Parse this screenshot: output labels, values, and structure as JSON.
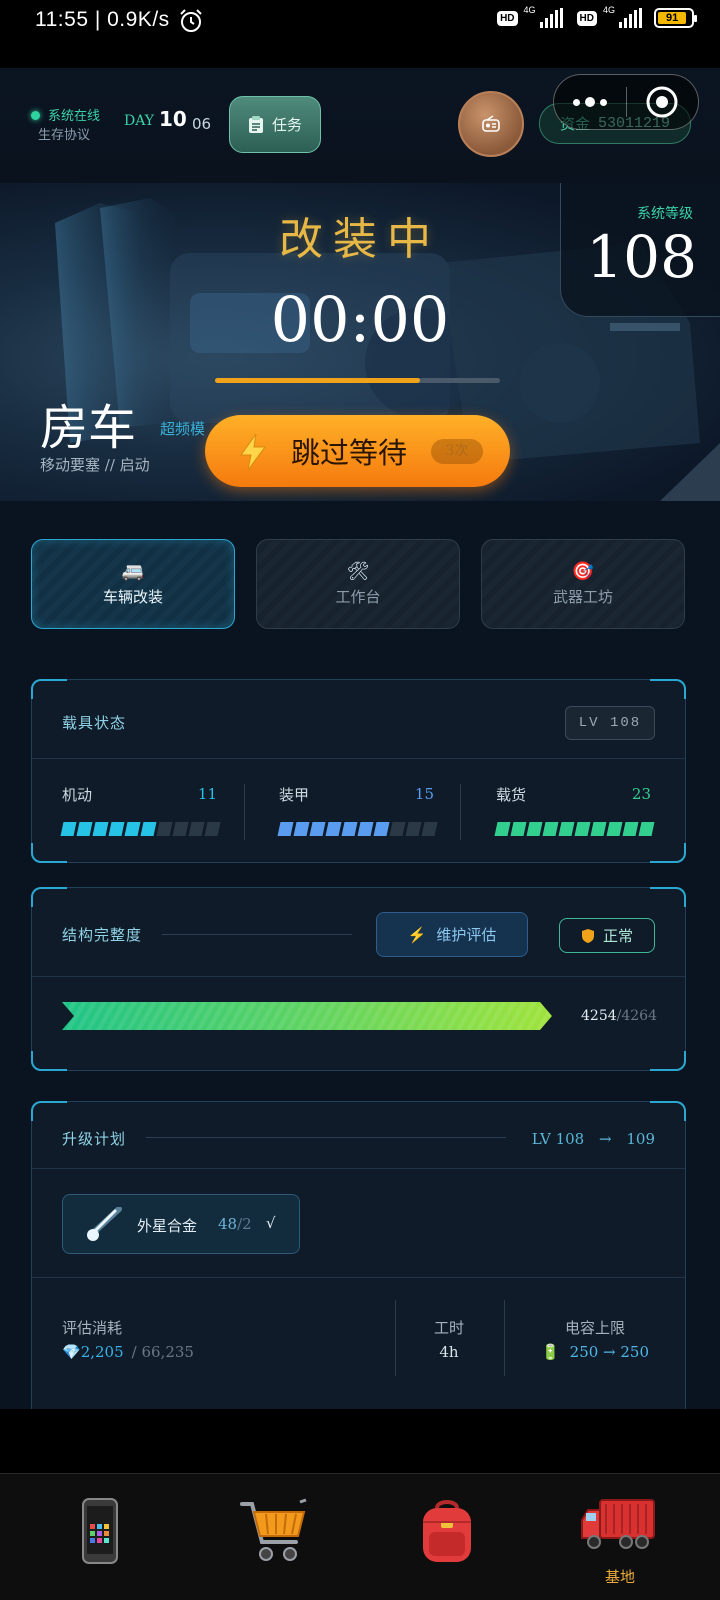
{
  "status_bar": {
    "time": "11:55 | 0.9K/s",
    "hd1": "HD",
    "net1": "4G",
    "hd2": "HD",
    "net2": "4G",
    "battery": "91"
  },
  "header": {
    "online": "系统在线",
    "protocol": "生存协议",
    "day_label": "DAY",
    "day_num": "10",
    "day_sub": "06",
    "task_label": "任务",
    "funds_label": "资金",
    "funds_value": "53011219"
  },
  "hero": {
    "title": "改装中",
    "timer": "00:00",
    "progress": 0.72,
    "level_label": "系统等级",
    "level_value": "108",
    "vehicle_name": "房车",
    "vehicle_mode": "超频模",
    "vehicle_sub": "移动要塞 // 启动",
    "skip_label": "跳过等待",
    "skip_count": "3次"
  },
  "tabs": [
    {
      "icon": "🚐",
      "label": "车辆改装",
      "active": true
    },
    {
      "icon": "🛠",
      "label": "工作台",
      "active": false
    },
    {
      "icon": "🎯",
      "label": "武器工坊",
      "active": false
    }
  ],
  "vehicle_status": {
    "title": "载具状态",
    "level": "LV 108",
    "stats": [
      {
        "name": "机动",
        "value": "11",
        "filled": 6,
        "total": 10,
        "color": "#27c3e6"
      },
      {
        "name": "装甲",
        "value": "15",
        "filled": 7,
        "total": 10,
        "color": "#5a9cf0"
      },
      {
        "name": "载货",
        "value": "23",
        "filled": 10,
        "total": 10,
        "color": "#33cf8f"
      }
    ]
  },
  "integrity": {
    "title": "结构完整度",
    "maint_label": "维护评估",
    "status_label": "正常",
    "current": "4254",
    "max": "/4264",
    "fraction": 0.998
  },
  "upgrade": {
    "title": "升级计划",
    "from": "LV 108",
    "arrow": "→",
    "to": "109",
    "material_name": "外星合金",
    "material_have": "48",
    "material_need": "/2",
    "material_check": "√",
    "cost_label": "评估消耗",
    "cost_value": "2,205",
    "cost_total": "/ 66,235",
    "time_label": "工时",
    "time_value": "4h",
    "cap_label": "电容上限",
    "cap_value": "250 → 250"
  },
  "bottom_nav": [
    {
      "icon": "phone-icon",
      "label": ""
    },
    {
      "icon": "cart-icon",
      "label": ""
    },
    {
      "icon": "backpack-icon",
      "label": ""
    },
    {
      "icon": "truck-icon",
      "label": "基地"
    }
  ]
}
